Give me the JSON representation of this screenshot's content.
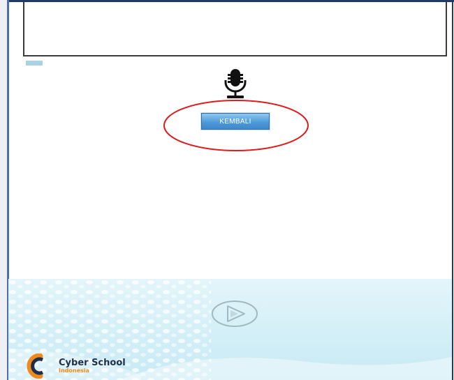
{
  "buttons": {
    "kembali_label": "KEMBALI"
  },
  "icons": {
    "microphone": "microphone-icon",
    "play": "play-icon",
    "logo": "cyber-school-logo"
  },
  "brand": {
    "name": "Cyber School",
    "subtitle": "Indonesia"
  },
  "colors": {
    "button_blue": "#4a97d8",
    "highlight_red": "#e01b1b",
    "footer_teal": "#d8f1f8",
    "brand_orange": "#f08a1c",
    "brand_navy": "#1f2f4a"
  }
}
